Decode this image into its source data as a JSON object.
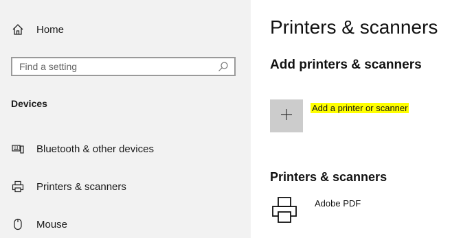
{
  "sidebar": {
    "home_label": "Home",
    "search_placeholder": "Find a setting",
    "section_label": "Devices",
    "items": [
      {
        "label": "Bluetooth & other devices",
        "icon": "bluetooth-devices-icon"
      },
      {
        "label": "Printers & scanners",
        "icon": "printer-icon"
      },
      {
        "label": "Mouse",
        "icon": "mouse-icon"
      }
    ]
  },
  "main": {
    "title": "Printers & scanners",
    "add_section_title": "Add printers & scanners",
    "add_button_icon": "plus-icon",
    "add_label": "Add a printer or scanner",
    "list_section_title": "Printers & scanners",
    "printers": [
      {
        "name": "Adobe PDF",
        "icon": "printer-icon"
      }
    ]
  },
  "colors": {
    "sidebar_bg": "#f2f2f2",
    "button_bg": "#cccccc",
    "highlight": "#ffff00"
  }
}
